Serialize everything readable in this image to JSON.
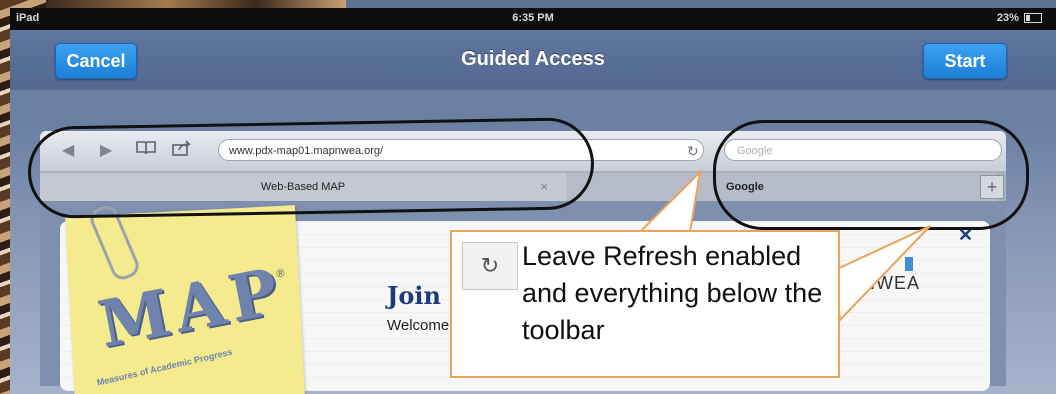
{
  "status_bar": {
    "carrier": "iPad",
    "time": "6:35 PM",
    "battery": "23%"
  },
  "guided_access": {
    "cancel_label": "Cancel",
    "title": "Guided Access",
    "start_label": "Start"
  },
  "safari": {
    "url": "www.pdx-map01.mapnwea.org/",
    "search_placeholder": "Google",
    "tabs": [
      {
        "label": "Web-Based MAP"
      },
      {
        "label": "Google"
      }
    ]
  },
  "webpage": {
    "logo_text": "MAP",
    "logo_tagline": "Measures of Academic Progress",
    "heading": "Join",
    "welcome": "Welcome",
    "brand": "NWEA"
  },
  "callout": {
    "text": "Leave Refresh enabled and everything below the toolbar"
  },
  "colors": {
    "button_blue": "#1b7fd6",
    "header": "#52688f",
    "callout_border": "#e8a35c"
  }
}
